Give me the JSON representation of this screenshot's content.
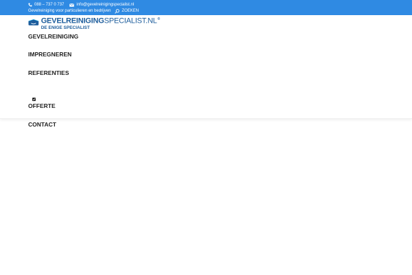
{
  "topbar": {
    "phone": "088 – 737 0 737",
    "email": "info@gevelreinigingspecialist.nl",
    "tagline": "Gevelreiniging voor particulieren en bedrijven",
    "search_label": "ZOEKEN",
    "background": "#2f8ae3",
    "icons": {
      "phone": "phone-icon",
      "email": "envelope-icon",
      "search": "search-icon"
    }
  },
  "logo": {
    "brand_bold": "GEVELREINIGING",
    "brand_light": "SPECIALIST.NL",
    "registered": "®",
    "tagline": "DE ENIGE SPECIALIST",
    "brand_color": "#1d5d9c",
    "accent_color": "#1eaee6"
  },
  "nav": {
    "items": [
      {
        "label": "GEVELREINIGING"
      },
      {
        "label": "IMPREGNEREN"
      },
      {
        "label": "REFERENTIES"
      },
      {
        "label": "OFFERTE"
      },
      {
        "label": "CONTACT"
      }
    ],
    "checkbox_icon": "checkbox-checked-icon",
    "checkbox_checked": true
  }
}
